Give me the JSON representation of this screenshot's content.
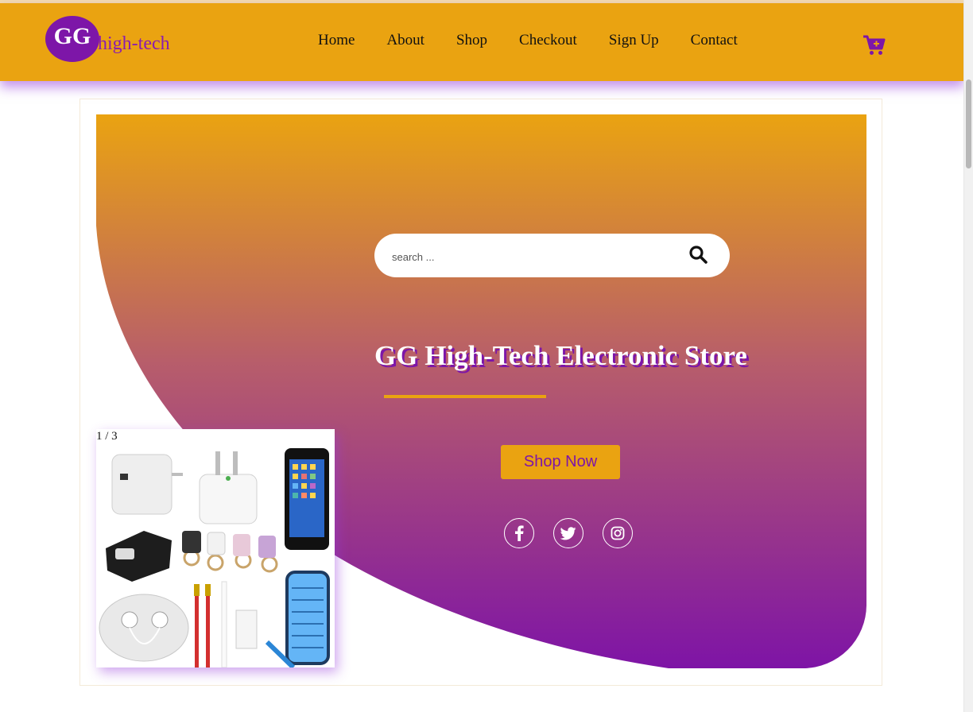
{
  "brand": {
    "logo_initials": "GG",
    "logo_text": "high-tech"
  },
  "nav": {
    "links": [
      {
        "label": "Home"
      },
      {
        "label": "About"
      },
      {
        "label": "Shop"
      },
      {
        "label": "Checkout"
      },
      {
        "label": "Sign Up"
      },
      {
        "label": "Contact"
      }
    ],
    "cart_icon": "cart-plus-icon"
  },
  "search": {
    "placeholder": "search ...",
    "value": "",
    "icon": "search-icon"
  },
  "hero": {
    "title": "GG High-Tech Electronic Store",
    "cta_label": "Shop Now"
  },
  "social": [
    {
      "icon": "facebook-icon"
    },
    {
      "icon": "twitter-icon"
    },
    {
      "icon": "instagram-icon"
    }
  ],
  "slideshow": {
    "counter": "1 / 3",
    "image_subject": "phone accessories: chargers, car charger, ring holders, earphones, cables, phone case"
  },
  "colors": {
    "primary_orange": "#eaa311",
    "primary_purple": "#7d16a8"
  }
}
